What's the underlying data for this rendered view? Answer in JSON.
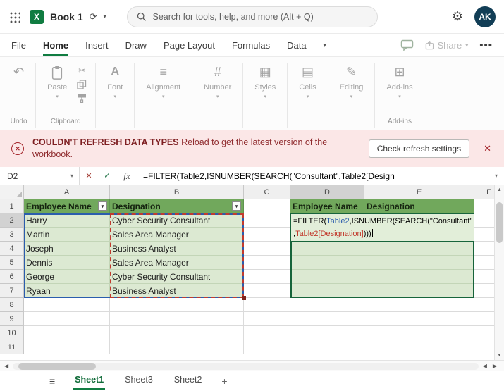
{
  "colors": {
    "excel_green": "#107C41",
    "banner_bg": "#FBE7E7",
    "banner_red": "#A4262C",
    "table_header_green": "#71A85C",
    "table_row_green": "#DCE9D2",
    "reference_blue": "#2B5DAD",
    "reference_red": "#C23B2E",
    "avatar_bg": "#123E56"
  },
  "topbar": {
    "workbook_title": "Book 1",
    "search_placeholder": "Search for tools, help, and more (Alt + Q)",
    "avatar_initials": "AK"
  },
  "menubar": {
    "items": [
      "File",
      "Home",
      "Insert",
      "Draw",
      "Page Layout",
      "Formulas",
      "Data"
    ],
    "active_item": "Home",
    "share_label": "Share"
  },
  "ribbon": {
    "undo_group": "Undo",
    "paste_label": "Paste",
    "clipboard_group": "Clipboard",
    "buttons": [
      "Font",
      "Alignment",
      "Number",
      "Styles",
      "Cells",
      "Editing",
      "Add-ins"
    ],
    "addins_group": "Add-ins"
  },
  "banner": {
    "title": "COULDN'T REFRESH DATA TYPES",
    "message": "Reload to get the latest version of the workbook.",
    "button_label": "Check refresh settings"
  },
  "formula_bar": {
    "name_box": "D2",
    "fx_label": "fx",
    "formula": "=FILTER(Table2,ISNUMBER(SEARCH(\"Consultant\",Table2[Design"
  },
  "grid": {
    "columns": [
      "A",
      "B",
      "C",
      "D",
      "E",
      "F"
    ],
    "rows": [
      "1",
      "2",
      "3",
      "4",
      "5",
      "6",
      "7",
      "8",
      "9",
      "10",
      "11"
    ],
    "selected_col": "D",
    "selected_row": "2",
    "table1": {
      "headers": [
        "Employee Name",
        "Designation"
      ],
      "rows": [
        [
          "Harry",
          "Cyber Security Consultant"
        ],
        [
          "Martin",
          "Sales Area Manager"
        ],
        [
          "Joseph",
          "Business Analyst"
        ],
        [
          "Dennis",
          "Sales Area Manager"
        ],
        [
          "George",
          "Cyber Security Consultant"
        ],
        [
          "Ryaan",
          "Business Analyst"
        ]
      ]
    },
    "table2_headers": [
      "Employee Name",
      "Designation"
    ],
    "formula_cell": {
      "line1": [
        [
          "=FILTER(",
          "k"
        ],
        [
          "Table2",
          "b"
        ],
        [
          ",ISNUMBER(SEARCH(\"Consultant\"",
          "k"
        ]
      ],
      "line2": [
        [
          ",",
          "k"
        ],
        [
          "Table2[Designation]",
          "r"
        ],
        [
          ")))",
          "k"
        ]
      ]
    }
  },
  "sheetbar": {
    "tabs": [
      "Sheet1",
      "Sheet3",
      "Sheet2"
    ],
    "active_tab": "Sheet1"
  }
}
